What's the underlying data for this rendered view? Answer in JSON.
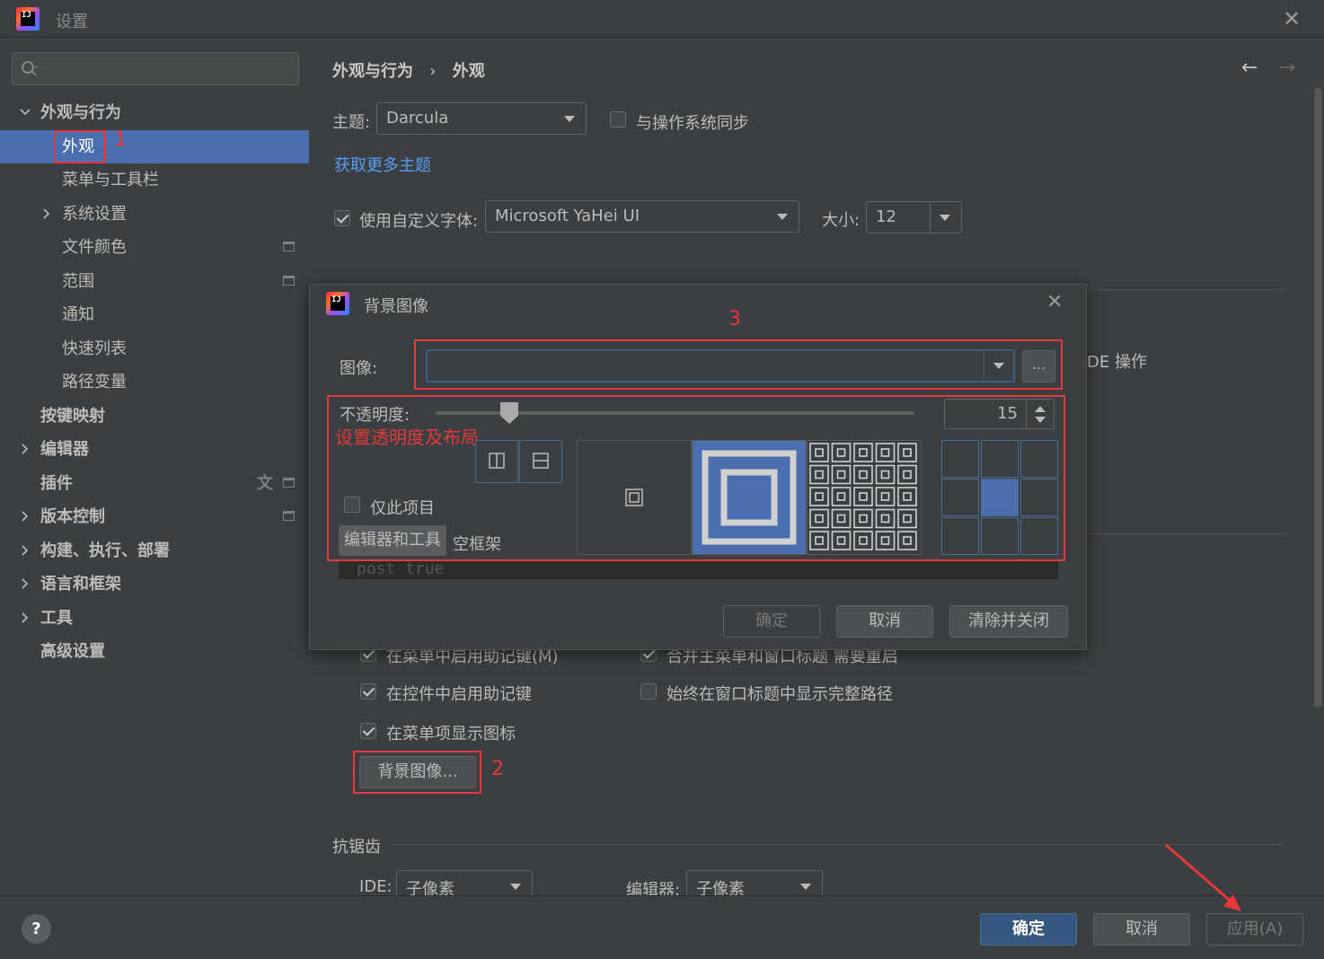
{
  "window": {
    "title": "设置",
    "logo_text": "IJ"
  },
  "search": {
    "placeholder": ""
  },
  "sidebar": {
    "items": [
      {
        "label": "外观与行为"
      },
      {
        "label": "外观"
      },
      {
        "label": "菜单与工具栏"
      },
      {
        "label": "系统设置"
      },
      {
        "label": "文件颜色"
      },
      {
        "label": "范围"
      },
      {
        "label": "通知"
      },
      {
        "label": "快速列表"
      },
      {
        "label": "路径变量"
      },
      {
        "label": "按键映射"
      },
      {
        "label": "编辑器"
      },
      {
        "label": "插件"
      },
      {
        "label": "版本控制"
      },
      {
        "label": "构建、执行、部署"
      },
      {
        "label": "语言和框架"
      },
      {
        "label": "工具"
      },
      {
        "label": "高级设置"
      }
    ]
  },
  "breadcrumb": {
    "parent": "外观与行为",
    "separator": "›",
    "current": "外观"
  },
  "nav": {
    "back": "←",
    "forward": "→"
  },
  "appearance": {
    "theme_label": "主题:",
    "theme_value": "Darcula",
    "sync_os_label": "与操作系统同步",
    "get_more_themes": "获取更多主题",
    "custom_font_label": "使用自定义字体:",
    "font_value": "Microsoft YaHei UI",
    "size_label": "大小:",
    "size_value": "12",
    "partial_ide_ops": "DE 操作"
  },
  "options": {
    "mnemonic_menu": "在菜单中启用助记键(M)",
    "merge_menu_title": "合并主菜单和窗口标题  需要重启",
    "mnemonic_controls": "在控件中启用助记键",
    "full_path_title": "始终在窗口标题中显示完整路径",
    "menu_icons": "在菜单项显示图标",
    "bg_image_button": "背景图像..."
  },
  "antialias": {
    "section": "抗锯齿",
    "ide_label": "IDE:",
    "ide_value": "子像素",
    "editor_label": "编辑器:",
    "editor_value": "子像素"
  },
  "footer": {
    "help": "?",
    "ok": "确定",
    "cancel": "取消",
    "apply": "应用(A)"
  },
  "dialog": {
    "title": "背景图像",
    "image_label": "图像:",
    "image_value": "",
    "browse": "...",
    "opacity_label": "不透明度:",
    "opacity_value": "15",
    "opacity_level": 0.15,
    "this_project_only": "仅此项目",
    "target_tag": "编辑器和工具",
    "target_empty_frame": "空框架",
    "strip_text": "post    true",
    "ok": "确定",
    "cancel": "取消",
    "clear_close": "清除并关闭"
  },
  "annotations": {
    "num1": "1",
    "num2": "2",
    "num3": "3",
    "note": "设置透明度及布局"
  },
  "colors": {
    "accent": "#4b6eaf",
    "annotation_red": "#e5383b",
    "link": "#589df6",
    "primary_button": "#365880"
  }
}
